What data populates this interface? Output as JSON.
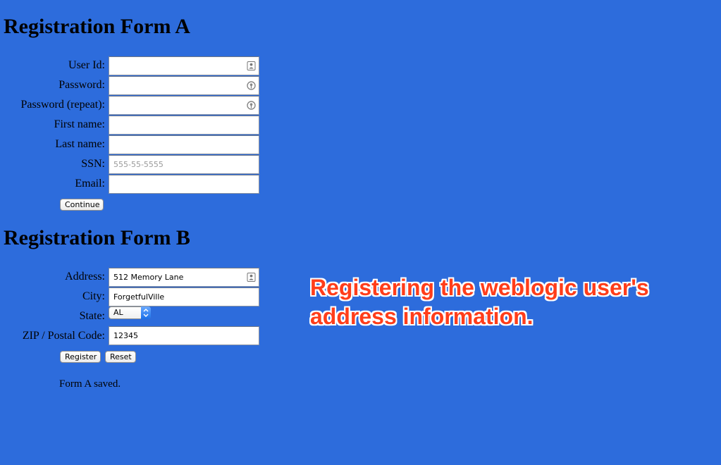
{
  "form_a": {
    "title": "Registration Form A",
    "fields": {
      "user_id": {
        "label": "User Id:",
        "value": ""
      },
      "password": {
        "label": "Password:",
        "value": ""
      },
      "password_repeat": {
        "label": "Password (repeat):",
        "value": ""
      },
      "first_name": {
        "label": "First name:",
        "value": ""
      },
      "last_name": {
        "label": "Last name:",
        "value": ""
      },
      "ssn": {
        "label": "SSN:",
        "value": "",
        "placeholder": "555-55-5555"
      },
      "email": {
        "label": "Email:",
        "value": ""
      }
    },
    "continue_label": "Continue"
  },
  "form_b": {
    "title": "Registration Form B",
    "fields": {
      "address": {
        "label": "Address:",
        "value": "512 Memory Lane"
      },
      "city": {
        "label": "City:",
        "value": "ForgetfulVille"
      },
      "state": {
        "label": "State:",
        "value": "AL"
      },
      "zip": {
        "label": "ZIP / Postal Code:",
        "value": "12345"
      }
    },
    "register_label": "Register",
    "reset_label": "Reset"
  },
  "status_message": "Form A saved.",
  "annotation": {
    "line1": "Registering the weblogic user's",
    "line2": "address information.",
    "color": "#ff3d1a"
  },
  "icons": {
    "contact_card": "contact-card-icon",
    "key": "password-key-icon",
    "select_arrows": "select-arrows-icon"
  },
  "colors": {
    "background": "#2d6cdc",
    "select_arrow": "#1a6fe8"
  }
}
